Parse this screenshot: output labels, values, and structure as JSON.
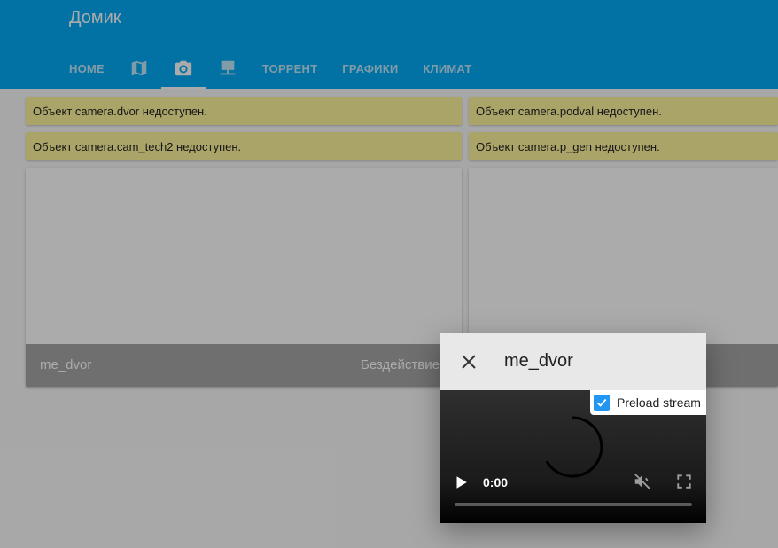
{
  "header": {
    "title": "Домик",
    "tabs": [
      {
        "label": "HOME",
        "icon": null
      },
      {
        "label": "",
        "icon": "map-icon"
      },
      {
        "label": "",
        "icon": "camera-icon",
        "active": true
      },
      {
        "label": "",
        "icon": "network-icon"
      },
      {
        "label": "ТОРРЕНТ",
        "icon": null
      },
      {
        "label": "ГРАФИКИ",
        "icon": null
      },
      {
        "label": "КЛИМАТ",
        "icon": null
      }
    ]
  },
  "warnings": [
    "Объект camera.dvor недоступен.",
    "Объект camera.podval недоступен.",
    "Объект camera.cam_tech2 недоступен.",
    "Объект camera.p_gen недоступен."
  ],
  "camera_card": {
    "name": "me_dvor",
    "state": "Бездействие"
  },
  "dialog": {
    "title": "me_dvor",
    "preload_label": "Preload stream",
    "preload_checked": true,
    "time": "0:00"
  },
  "colors": {
    "header": "#03a9f4",
    "warning": "#fff59d",
    "checkbox": "#2196f3"
  }
}
